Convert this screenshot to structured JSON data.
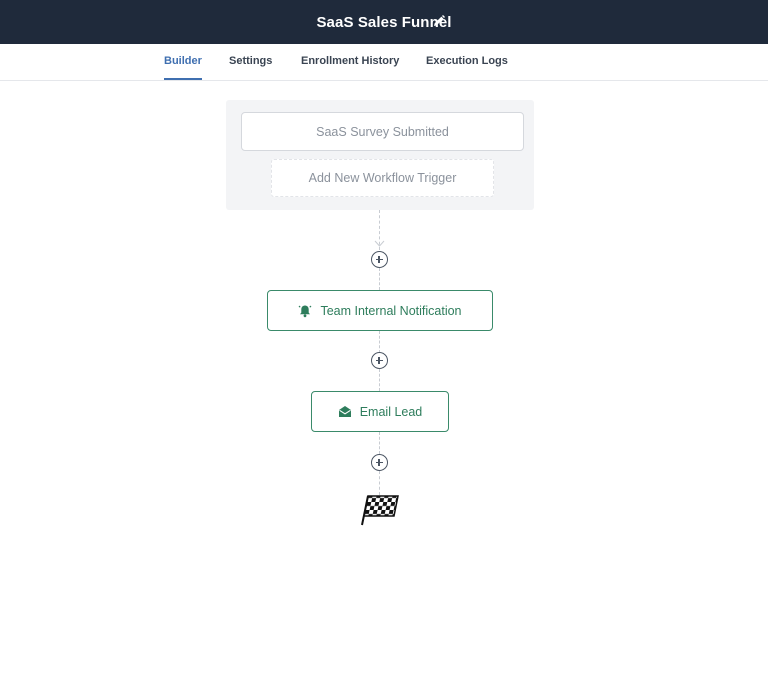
{
  "header": {
    "title": "SaaS Sales Funnel",
    "edit_icon": "pencil-icon"
  },
  "tabs": [
    {
      "label": "Builder",
      "active": true
    },
    {
      "label": "Settings",
      "active": false
    },
    {
      "label": "Enrollment History",
      "active": false
    },
    {
      "label": "Execution Logs",
      "active": false
    }
  ],
  "workflow": {
    "trigger": {
      "label": "SaaS Survey Submitted"
    },
    "add_trigger_label": "Add New Workflow Trigger",
    "actions": [
      {
        "label": "Team Internal Notification",
        "icon": "bell-icon"
      },
      {
        "label": "Email Lead",
        "icon": "envelope-icon"
      }
    ],
    "end_icon": "checkered-flag-icon"
  },
  "colors": {
    "header_bg": "#1f2a3b",
    "active_tab": "#3f6fb0",
    "action_accent": "#2e7d5c"
  }
}
